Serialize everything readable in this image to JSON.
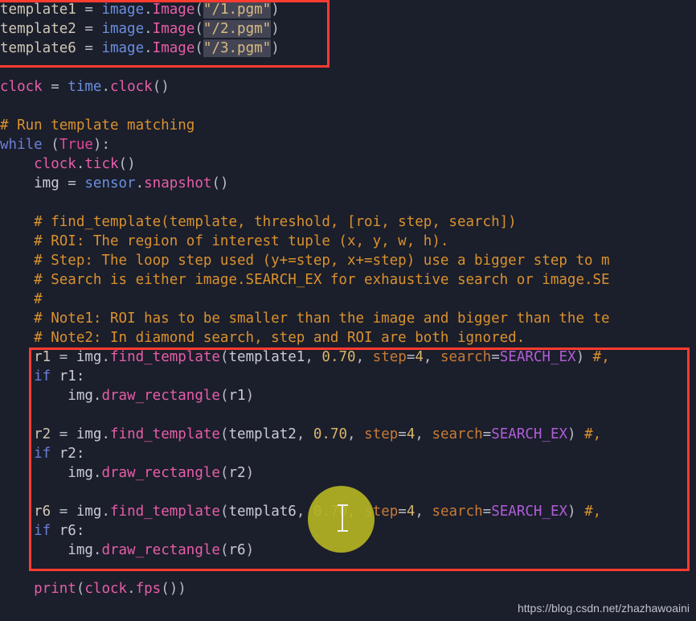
{
  "editor": {
    "background_color": "#1b1e2b",
    "font_size_px": 17.5,
    "line_height_px": 24
  },
  "colors": {
    "annotation_red": "#ff3b30",
    "click_indicator": "#b3b324",
    "comment": "#d9922e",
    "keyword": "#6b7fd7",
    "function": "#e65ea8",
    "module": "#6a8fe0",
    "string": "#d9bb80",
    "number": "#d8b56b",
    "param": "#c77b35",
    "class": "#b05ed8",
    "plain_text": "#c9cbd4",
    "string_highlight_bg": "#434554"
  },
  "code_lines": [
    {
      "id": "line-template1",
      "tokens": [
        {
          "text": "template1 ",
          "cls": "t-var"
        },
        {
          "text": "= ",
          "cls": "t-punct"
        },
        {
          "text": "image",
          "cls": "t-mod"
        },
        {
          "text": ".",
          "cls": "t-punct"
        },
        {
          "text": "Image",
          "cls": "t-attr"
        },
        {
          "text": "(",
          "cls": "t-punct"
        },
        {
          "text": "\"/1.pgm\"",
          "cls": "t-str str-hl"
        },
        {
          "text": ")",
          "cls": "t-punct"
        }
      ]
    },
    {
      "id": "line-template2",
      "tokens": [
        {
          "text": "template2 ",
          "cls": "t-var"
        },
        {
          "text": "= ",
          "cls": "t-punct"
        },
        {
          "text": "image",
          "cls": "t-mod"
        },
        {
          "text": ".",
          "cls": "t-punct"
        },
        {
          "text": "Image",
          "cls": "t-attr"
        },
        {
          "text": "(",
          "cls": "t-punct"
        },
        {
          "text": "\"/2.pgm\"",
          "cls": "t-str str-hl"
        },
        {
          "text": ")",
          "cls": "t-punct"
        }
      ]
    },
    {
      "id": "line-template6",
      "tokens": [
        {
          "text": "template6 ",
          "cls": "t-var"
        },
        {
          "text": "= ",
          "cls": "t-punct"
        },
        {
          "text": "image",
          "cls": "t-mod"
        },
        {
          "text": ".",
          "cls": "t-punct"
        },
        {
          "text": "Image",
          "cls": "t-attr"
        },
        {
          "text": "(",
          "cls": "t-punct"
        },
        {
          "text": "\"/3.pgm\"",
          "cls": "t-str str-hl"
        },
        {
          "text": ")",
          "cls": "t-punct"
        }
      ]
    },
    {
      "id": "line-blank-1",
      "tokens": []
    },
    {
      "id": "line-clock-assign",
      "tokens": [
        {
          "text": "clock ",
          "cls": "t-attr"
        },
        {
          "text": "= ",
          "cls": "t-punct"
        },
        {
          "text": "time",
          "cls": "t-mod"
        },
        {
          "text": ".",
          "cls": "t-punct"
        },
        {
          "text": "clock",
          "cls": "t-attr"
        },
        {
          "text": "()",
          "cls": "t-punct"
        }
      ]
    },
    {
      "id": "line-blank-2",
      "tokens": []
    },
    {
      "id": "line-comment-run",
      "tokens": [
        {
          "text": "# Run template matching",
          "cls": "t-comment"
        }
      ]
    },
    {
      "id": "line-while",
      "tokens": [
        {
          "text": "while ",
          "cls": "t-kw"
        },
        {
          "text": "(",
          "cls": "t-punct"
        },
        {
          "text": "True",
          "cls": "t-const"
        },
        {
          "text": "):",
          "cls": "t-punct"
        }
      ]
    },
    {
      "id": "line-clock-tick",
      "tokens": [
        {
          "text": "    clock",
          "cls": "t-attr"
        },
        {
          "text": ".",
          "cls": "t-punct"
        },
        {
          "text": "tick",
          "cls": "t-attr"
        },
        {
          "text": "()",
          "cls": "t-punct"
        }
      ]
    },
    {
      "id": "line-img-snapshot",
      "tokens": [
        {
          "text": "    img ",
          "cls": "t-plain"
        },
        {
          "text": "= ",
          "cls": "t-punct"
        },
        {
          "text": "sensor",
          "cls": "t-mod"
        },
        {
          "text": ".",
          "cls": "t-punct"
        },
        {
          "text": "snapshot",
          "cls": "t-attr"
        },
        {
          "text": "()",
          "cls": "t-punct"
        }
      ]
    },
    {
      "id": "line-blank-3",
      "tokens": []
    },
    {
      "id": "line-comment-signature",
      "tokens": [
        {
          "text": "    # find_template(template, threshold, [roi, step, search])",
          "cls": "t-comment"
        }
      ]
    },
    {
      "id": "line-comment-roi",
      "tokens": [
        {
          "text": "    # ROI: The region of interest tuple (x, y, w, h).",
          "cls": "t-comment"
        }
      ]
    },
    {
      "id": "line-comment-step",
      "tokens": [
        {
          "text": "    # Step: The loop step used (y+=step, x+=step) use a bigger step to m",
          "cls": "t-comment"
        }
      ]
    },
    {
      "id": "line-comment-search",
      "tokens": [
        {
          "text": "    # Search is either image.SEARCH_EX for exhaustive search or image.SE",
          "cls": "t-comment"
        }
      ]
    },
    {
      "id": "line-comment-hash",
      "tokens": [
        {
          "text": "    #",
          "cls": "t-comment"
        }
      ]
    },
    {
      "id": "line-comment-note1",
      "tokens": [
        {
          "text": "    # Note1: ROI has to be smaller than the image and bigger than the te",
          "cls": "t-comment"
        }
      ]
    },
    {
      "id": "line-comment-note2",
      "tokens": [
        {
          "text": "    # Note2: In diamond search, step and ROI are both ignored.",
          "cls": "t-comment"
        }
      ]
    },
    {
      "id": "line-r1-find",
      "tokens": [
        {
          "text": "    r1 ",
          "cls": "t-var"
        },
        {
          "text": "= ",
          "cls": "t-punct"
        },
        {
          "text": "img",
          "cls": "t-plain"
        },
        {
          "text": ".",
          "cls": "t-punct"
        },
        {
          "text": "find_template",
          "cls": "t-attr"
        },
        {
          "text": "(",
          "cls": "t-punct"
        },
        {
          "text": "template1",
          "cls": "t-plain"
        },
        {
          "text": ", ",
          "cls": "t-punct"
        },
        {
          "text": "0.70",
          "cls": "t-num"
        },
        {
          "text": ", ",
          "cls": "t-punct"
        },
        {
          "text": "step",
          "cls": "t-param"
        },
        {
          "text": "=",
          "cls": "t-punct"
        },
        {
          "text": "4",
          "cls": "t-num"
        },
        {
          "text": ", ",
          "cls": "t-punct"
        },
        {
          "text": "search",
          "cls": "t-param"
        },
        {
          "text": "=",
          "cls": "t-punct"
        },
        {
          "text": "SEARCH_EX",
          "cls": "t-class"
        },
        {
          "text": ") ",
          "cls": "t-punct"
        },
        {
          "text": "#,",
          "cls": "t-comment"
        }
      ]
    },
    {
      "id": "line-r1-if",
      "tokens": [
        {
          "text": "    if ",
          "cls": "t-kw"
        },
        {
          "text": "r1:",
          "cls": "t-plain"
        }
      ]
    },
    {
      "id": "line-r1-draw",
      "tokens": [
        {
          "text": "        img",
          "cls": "t-plain"
        },
        {
          "text": ".",
          "cls": "t-punct"
        },
        {
          "text": "draw_rectangle",
          "cls": "t-attr"
        },
        {
          "text": "(",
          "cls": "t-punct"
        },
        {
          "text": "r1",
          "cls": "t-plain"
        },
        {
          "text": ")",
          "cls": "t-punct"
        }
      ]
    },
    {
      "id": "line-blank-4",
      "tokens": []
    },
    {
      "id": "line-r2-find",
      "tokens": [
        {
          "text": "    r2 ",
          "cls": "t-var"
        },
        {
          "text": "= ",
          "cls": "t-punct"
        },
        {
          "text": "img",
          "cls": "t-plain"
        },
        {
          "text": ".",
          "cls": "t-punct"
        },
        {
          "text": "find_template",
          "cls": "t-attr"
        },
        {
          "text": "(",
          "cls": "t-punct"
        },
        {
          "text": "templat2",
          "cls": "t-plain"
        },
        {
          "text": ", ",
          "cls": "t-punct"
        },
        {
          "text": "0.70",
          "cls": "t-num"
        },
        {
          "text": ", ",
          "cls": "t-punct"
        },
        {
          "text": "step",
          "cls": "t-param"
        },
        {
          "text": "=",
          "cls": "t-punct"
        },
        {
          "text": "4",
          "cls": "t-num"
        },
        {
          "text": ", ",
          "cls": "t-punct"
        },
        {
          "text": "search",
          "cls": "t-param"
        },
        {
          "text": "=",
          "cls": "t-punct"
        },
        {
          "text": "SEARCH_EX",
          "cls": "t-class"
        },
        {
          "text": ") ",
          "cls": "t-punct"
        },
        {
          "text": "#,",
          "cls": "t-comment"
        }
      ]
    },
    {
      "id": "line-r2-if",
      "tokens": [
        {
          "text": "    if ",
          "cls": "t-kw"
        },
        {
          "text": "r2:",
          "cls": "t-plain"
        }
      ]
    },
    {
      "id": "line-r2-draw",
      "tokens": [
        {
          "text": "        img",
          "cls": "t-plain"
        },
        {
          "text": ".",
          "cls": "t-punct"
        },
        {
          "text": "draw_rectangle",
          "cls": "t-attr"
        },
        {
          "text": "(",
          "cls": "t-punct"
        },
        {
          "text": "r2",
          "cls": "t-plain"
        },
        {
          "text": ")",
          "cls": "t-punct"
        }
      ]
    },
    {
      "id": "line-blank-5",
      "tokens": []
    },
    {
      "id": "line-r6-find",
      "tokens": [
        {
          "text": "    r6 ",
          "cls": "t-var"
        },
        {
          "text": "= ",
          "cls": "t-punct"
        },
        {
          "text": "img",
          "cls": "t-plain"
        },
        {
          "text": ".",
          "cls": "t-punct"
        },
        {
          "text": "find_template",
          "cls": "t-attr"
        },
        {
          "text": "(",
          "cls": "t-punct"
        },
        {
          "text": "templat6",
          "cls": "t-plain"
        },
        {
          "text": ", ",
          "cls": "t-punct"
        },
        {
          "text": "0.70",
          "cls": "t-num"
        },
        {
          "text": ", ",
          "cls": "t-punct"
        },
        {
          "text": "step",
          "cls": "t-param"
        },
        {
          "text": "=",
          "cls": "t-punct"
        },
        {
          "text": "4",
          "cls": "t-num"
        },
        {
          "text": ", ",
          "cls": "t-punct"
        },
        {
          "text": "search",
          "cls": "t-param"
        },
        {
          "text": "=",
          "cls": "t-punct"
        },
        {
          "text": "SEARCH_EX",
          "cls": "t-class"
        },
        {
          "text": ") ",
          "cls": "t-punct"
        },
        {
          "text": "#,",
          "cls": "t-comment"
        }
      ]
    },
    {
      "id": "line-r6-if",
      "tokens": [
        {
          "text": "    if ",
          "cls": "t-kw"
        },
        {
          "text": "r6:",
          "cls": "t-plain"
        }
      ]
    },
    {
      "id": "line-r6-draw",
      "tokens": [
        {
          "text": "        img",
          "cls": "t-plain"
        },
        {
          "text": ".",
          "cls": "t-punct"
        },
        {
          "text": "draw_rectangle",
          "cls": "t-attr"
        },
        {
          "text": "(",
          "cls": "t-punct"
        },
        {
          "text": "r6",
          "cls": "t-plain"
        },
        {
          "text": ")",
          "cls": "t-punct"
        }
      ]
    },
    {
      "id": "line-blank-6",
      "tokens": []
    },
    {
      "id": "line-print-fps",
      "tokens": [
        {
          "text": "    print",
          "cls": "t-func"
        },
        {
          "text": "(",
          "cls": "t-punct"
        },
        {
          "text": "clock",
          "cls": "t-attr"
        },
        {
          "text": ".",
          "cls": "t-punct"
        },
        {
          "text": "fps",
          "cls": "t-attr"
        },
        {
          "text": "())",
          "cls": "t-punct"
        }
      ]
    }
  ],
  "annotations": [
    {
      "id": "annot-top",
      "label": "template-declarations-highlight"
    },
    {
      "id": "annot-main",
      "label": "find-template-calls-highlight"
    }
  ],
  "click_indicator": {
    "label": "click-highlight",
    "caret_label": "text-cursor"
  },
  "watermark": {
    "text": "https://blog.csdn.net/zhazhawoaini"
  }
}
